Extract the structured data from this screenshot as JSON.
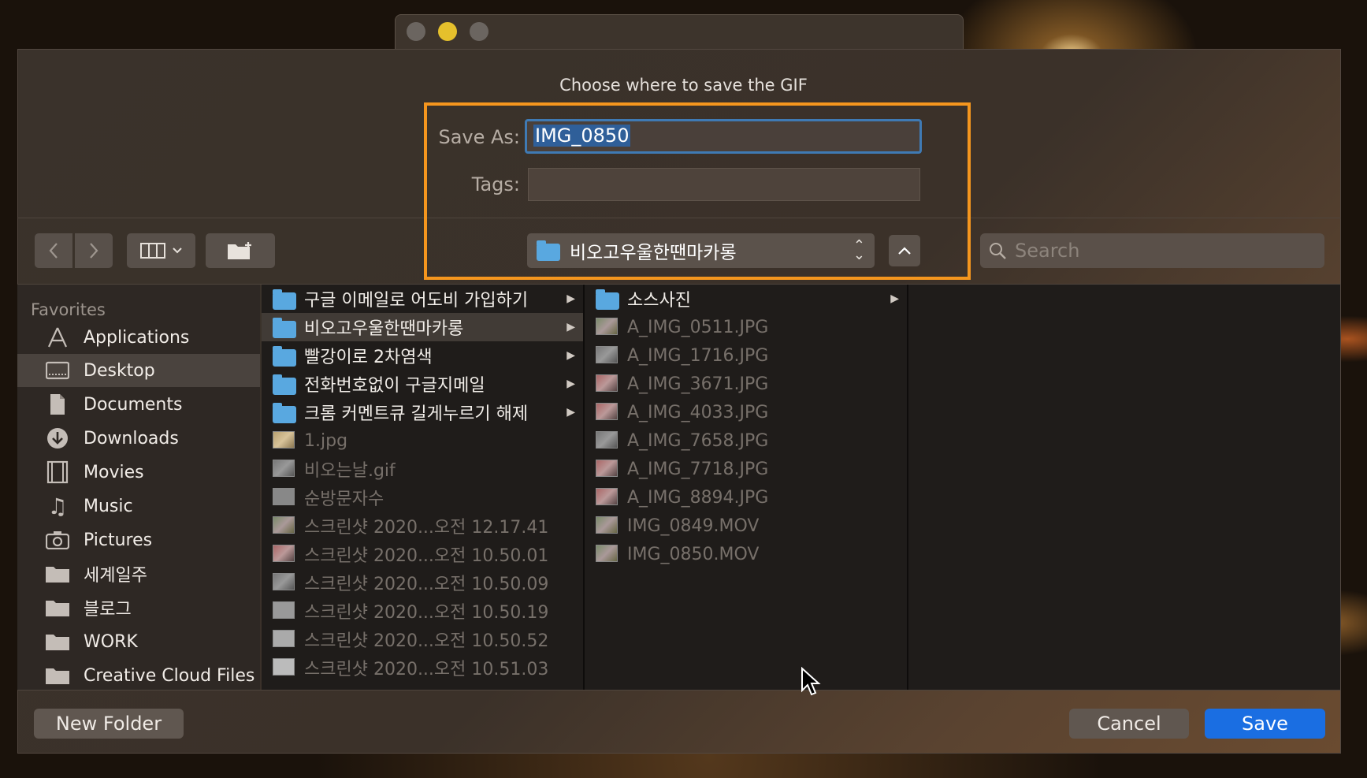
{
  "dialog": {
    "title": "Choose where to save the GIF",
    "save_as_label": "Save As:",
    "save_as_value": "IMG_0850",
    "tags_label": "Tags:",
    "tags_value": ""
  },
  "toolbar": {
    "back_icon": "chevron-left-icon",
    "forward_icon": "chevron-right-icon",
    "view_icon": "column-view-icon",
    "new_folder_icon": "new-folder-icon",
    "location": "비오고우울한땐마카롱",
    "search_placeholder": "Search"
  },
  "sidebar": {
    "heading": "Favorites",
    "items": [
      {
        "label": "Applications",
        "icon": "applications-icon"
      },
      {
        "label": "Desktop",
        "icon": "desktop-icon",
        "active": true
      },
      {
        "label": "Documents",
        "icon": "documents-icon"
      },
      {
        "label": "Downloads",
        "icon": "downloads-icon"
      },
      {
        "label": "Movies",
        "icon": "movies-icon"
      },
      {
        "label": "Music",
        "icon": "music-icon"
      },
      {
        "label": "Pictures",
        "icon": "pictures-icon"
      },
      {
        "label": "세계일주",
        "icon": "folder-icon"
      },
      {
        "label": "블로그",
        "icon": "folder-icon"
      },
      {
        "label": "WORK",
        "icon": "folder-icon"
      },
      {
        "label": "Creative Cloud Files",
        "icon": "folder-icon"
      }
    ]
  },
  "column1": {
    "items": [
      {
        "label": "구글 이메일로 어도비 가입하기",
        "type": "folder"
      },
      {
        "label": "비오고우울한땐마카롱",
        "type": "folder",
        "selected": true
      },
      {
        "label": "빨강이로 2차염색",
        "type": "folder"
      },
      {
        "label": "전화번호없이 구글지메일",
        "type": "folder"
      },
      {
        "label": "크롬 커멘트큐 길게누르기 해제",
        "type": "folder"
      },
      {
        "label": "1.jpg",
        "type": "file"
      },
      {
        "label": "비오는날.gif",
        "type": "file"
      },
      {
        "label": "순방문자수",
        "type": "file"
      },
      {
        "label": "스크린샷 2020...오전 12.17.41",
        "type": "file"
      },
      {
        "label": "스크린샷 2020...오전 10.50.01",
        "type": "file"
      },
      {
        "label": "스크린샷 2020...오전 10.50.09",
        "type": "file"
      },
      {
        "label": "스크린샷 2020...오전 10.50.19",
        "type": "file"
      },
      {
        "label": "스크린샷 2020...오전 10.50.52",
        "type": "file"
      },
      {
        "label": "스크린샷 2020...오전 10.51.03",
        "type": "file"
      }
    ]
  },
  "column2": {
    "items": [
      {
        "label": "소스사진",
        "type": "folder"
      },
      {
        "label": "A_IMG_0511.JPG",
        "type": "file"
      },
      {
        "label": "A_IMG_1716.JPG",
        "type": "file"
      },
      {
        "label": "A_IMG_3671.JPG",
        "type": "file"
      },
      {
        "label": "A_IMG_4033.JPG",
        "type": "file"
      },
      {
        "label": "A_IMG_7658.JPG",
        "type": "file"
      },
      {
        "label": "A_IMG_7718.JPG",
        "type": "file"
      },
      {
        "label": "A_IMG_8894.JPG",
        "type": "file"
      },
      {
        "label": "IMG_0849.MOV",
        "type": "file"
      },
      {
        "label": "IMG_0850.MOV",
        "type": "file"
      }
    ]
  },
  "buttons": {
    "new_folder": "New Folder",
    "cancel": "Cancel",
    "save": "Save"
  },
  "colors": {
    "accent": "#1a6ee2",
    "highlight": "#f5961e",
    "folder": "#59a8e0"
  }
}
